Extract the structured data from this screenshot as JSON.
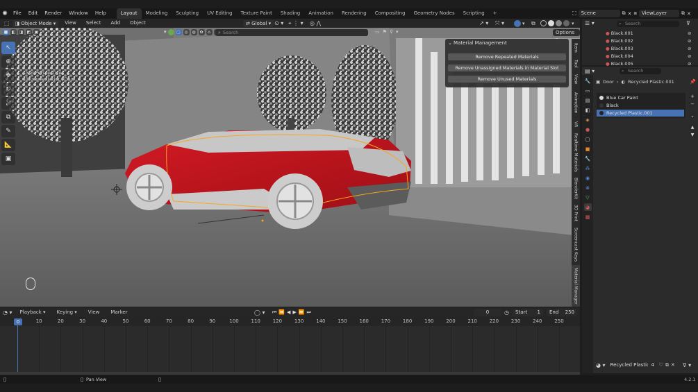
{
  "menubar": {
    "items": [
      "File",
      "Edit",
      "Render",
      "Window",
      "Help"
    ],
    "workspaces": [
      "Layout",
      "Modeling",
      "Sculpting",
      "UV Editing",
      "Texture Paint",
      "Shading",
      "Animation",
      "Rendering",
      "Compositing",
      "Geometry Nodes",
      "Scripting"
    ],
    "active_workspace": "Layout",
    "scene": "Scene",
    "view_layer": "ViewLayer"
  },
  "viewport_header": {
    "mode": "Object Mode",
    "menus": [
      "View",
      "Select",
      "Add",
      "Object"
    ],
    "transform_orientation": "Global",
    "search_placeholder": "Search",
    "options": "Options"
  },
  "overlay": {
    "line1": "User Perspective",
    "line2": "(0) new exterior | Door"
  },
  "npanel": {
    "title": "Material Management",
    "buttons": [
      "Remove Repeated Materials",
      "Remove Unassigned Materials in Material Slot",
      "Remove Unused Materials"
    ]
  },
  "sidebar_tabs": [
    "Item",
    "Tool",
    "View",
    "Animotion",
    "VR",
    "Realtime Materials",
    "BlenderKit",
    "3D Print",
    "Screencast Keys",
    "Material Manager"
  ],
  "timeline": {
    "menus": [
      "Playback",
      "Keying",
      "View",
      "Marker"
    ],
    "current_frame": "0",
    "start_label": "Start",
    "start": "1",
    "end_label": "End",
    "end": "250",
    "ticks": [
      "0",
      "10",
      "20",
      "30",
      "40",
      "50",
      "60",
      "70",
      "80",
      "90",
      "100",
      "110",
      "120",
      "130",
      "140",
      "150",
      "160",
      "170",
      "180",
      "190",
      "200",
      "210",
      "220",
      "230",
      "240",
      "250"
    ]
  },
  "outliner": {
    "search_placeholder": "Search",
    "items": [
      "Black.001",
      "Black.002",
      "Black.003",
      "Black.004",
      "Black.005"
    ]
  },
  "properties": {
    "search_placeholder": "Search",
    "breadcrumb_object": "Door",
    "breadcrumb_material": "Recycled Plastic.001",
    "materials": [
      {
        "name": "Blue Car Paint",
        "color": "#d8d8d8"
      },
      {
        "name": "Black",
        "color": "#333333"
      },
      {
        "name": "Recycled Plastic.001",
        "color": "#222222"
      }
    ],
    "selected_material": 2,
    "material_field": "Recycled Plastic....",
    "user_count": "4"
  },
  "statusbar": {
    "hint": "Pan View",
    "version": "4.2.1"
  },
  "colors": {
    "accent": "#4772b3",
    "car_red": "#c4141e",
    "selection_outline": "#f5a623"
  }
}
